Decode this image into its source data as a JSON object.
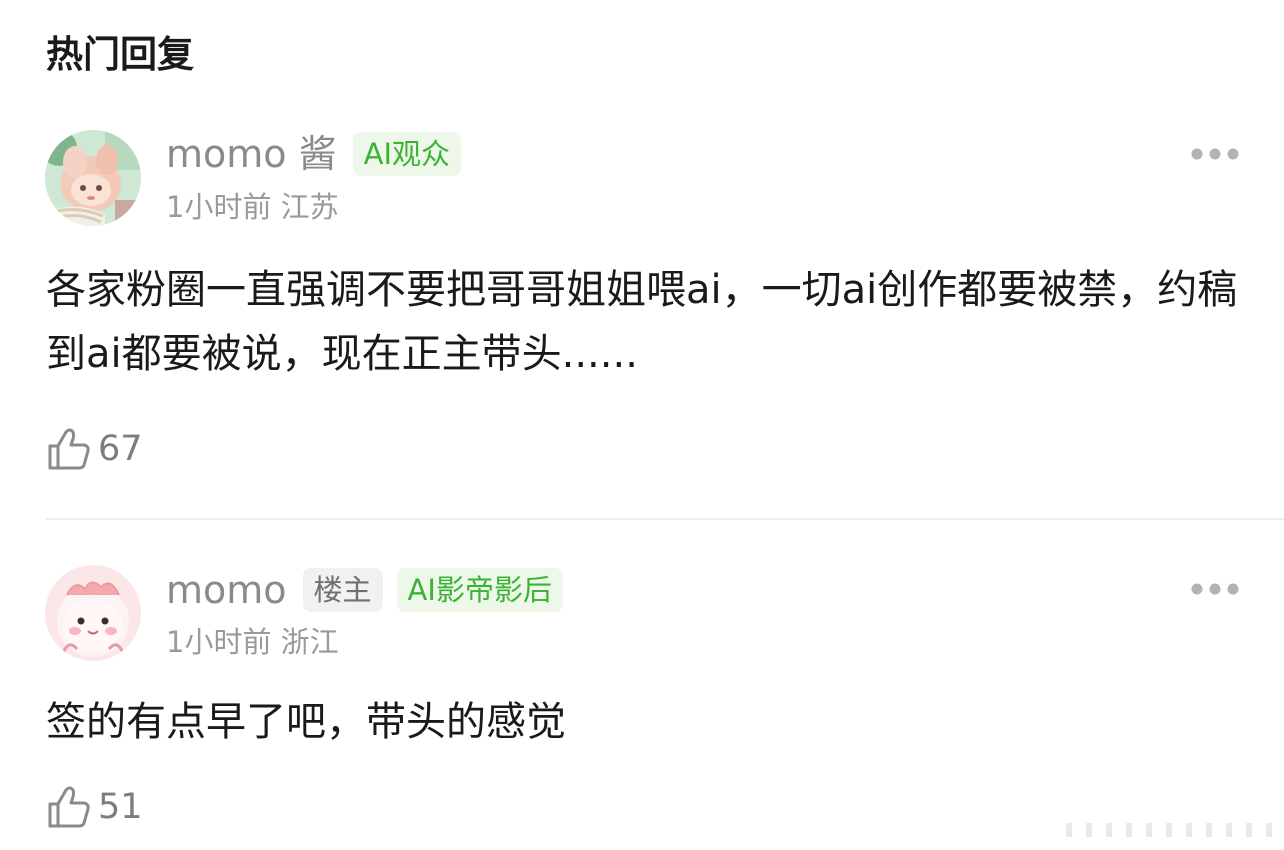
{
  "section": {
    "title": "热门回复"
  },
  "comments": [
    {
      "username": "momo 酱",
      "badges": [
        "AI观众"
      ],
      "time": "1小时前",
      "location": "江苏",
      "text": "各家粉圈一直强调不要把哥哥姐姐喂ai，一切ai创作都要被禁，约稿到ai都要被说，现在正主带头......",
      "likes": "67",
      "avatar_icon": "anime-character-avatar",
      "more_icon": "more-dots-icon",
      "like_icon": "thumbs-up-icon"
    },
    {
      "username": "momo",
      "badges": [
        "楼主",
        "AI影帝影后"
      ],
      "time": "1小时前",
      "location": "浙江",
      "text": "签的有点早了吧，带头的感觉",
      "likes": "51",
      "avatar_icon": "pink-cartoon-avatar",
      "more_icon": "more-dots-icon",
      "like_icon": "thumbs-up-icon"
    }
  ],
  "colors": {
    "badge_green_text": "#3cb334",
    "badge_green_bg": "#eef8ea",
    "badge_gray_text": "#707070",
    "badge_gray_bg": "#f1f1f1",
    "username": "#8a8a8a",
    "body_text": "#1a1a1a"
  }
}
